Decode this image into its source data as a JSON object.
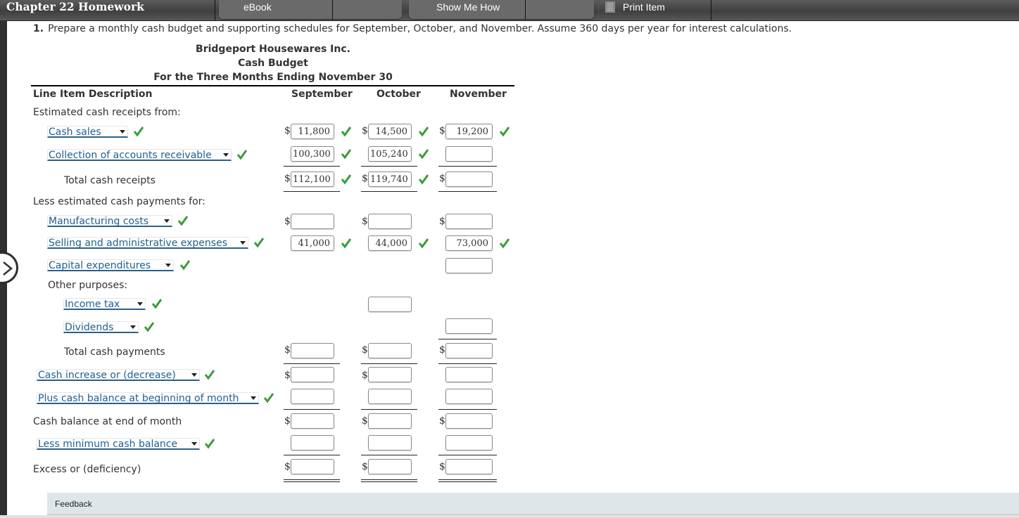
{
  "toolbar": {
    "title": "Chapter 22 Homework",
    "tabs": [
      {
        "label": "eBook",
        "icon": "none"
      },
      {
        "label": "Show Me How",
        "icon": "none"
      }
    ],
    "print_label": "Print Item",
    "print_icon": "document-icon"
  },
  "question": {
    "number": "1.",
    "text": "Prepare a monthly cash budget and supporting schedules for September, October, and November. Assume 360 days per year for interest calculations."
  },
  "statement": {
    "company": "Bridgeport Housewares Inc.",
    "title": "Cash Budget",
    "period": "For the Three Months Ending November 30",
    "columns": {
      "description": "Line Item Description",
      "months": [
        "September",
        "October",
        "November"
      ]
    }
  },
  "labels": {
    "receipts_heading": "Estimated cash receipts from:",
    "total_receipts": "Total cash receipts",
    "payments_heading": "Less estimated cash payments for:",
    "other_purposes": "Other purposes:",
    "total_payments": "Total cash payments",
    "end_balance": "Cash balance at end of month",
    "excess": "Excess or (deficiency)",
    "currency": "$"
  },
  "dropdowns": {
    "cash_sales": "Cash sales",
    "collections": "Collection of accounts receivable",
    "manufacturing": "Manufacturing costs",
    "selling_admin": "Selling and administrative expenses",
    "capital_exp": "Capital expenditures",
    "income_tax": "Income tax",
    "dividends": "Dividends",
    "cash_change": "Cash increase or (decrease)",
    "beginning_balance": "Plus cash balance at beginning of month",
    "min_balance": "Less minimum cash balance"
  },
  "values": {
    "cash_sales": [
      "11,800",
      "14,500",
      "19,200"
    ],
    "collections": [
      "100,300",
      "105,240",
      ""
    ],
    "total_receipts": [
      "112,100",
      "119,740",
      ""
    ],
    "manufacturing": [
      "",
      "",
      ""
    ],
    "selling_admin": [
      "41,000",
      "44,000",
      "73,000"
    ],
    "capital_exp": [
      "",
      "",
      ""
    ],
    "income_tax": [
      "",
      "",
      ""
    ],
    "dividends": [
      "",
      "",
      ""
    ],
    "total_payments": [
      "",
      "",
      ""
    ],
    "cash_change": [
      "",
      "",
      ""
    ],
    "beginning_balance": [
      "",
      "",
      ""
    ],
    "end_balance": [
      "",
      "",
      ""
    ],
    "min_balance": [
      "",
      "",
      ""
    ],
    "excess": [
      "",
      "",
      ""
    ]
  },
  "status": {
    "correct_color": "#3a9c3a",
    "link_color": "#1f5f92"
  },
  "feedback": {
    "label": "Feedback"
  }
}
